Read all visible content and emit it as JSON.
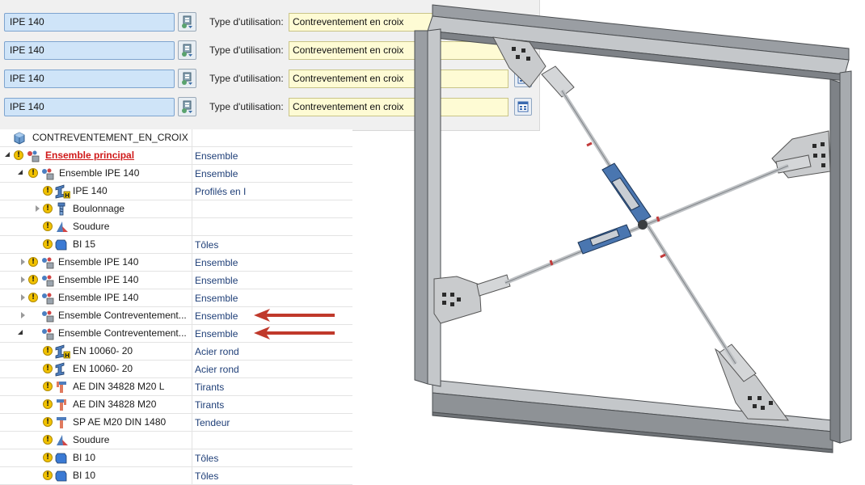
{
  "properties": [
    {
      "profile": "IPE 140",
      "usage_label": "Type d'utilisation:",
      "usage_value": "Contreventement en croix"
    },
    {
      "profile": "IPE 140",
      "usage_label": "Type d'utilisation:",
      "usage_value": "Contreventement en croix"
    },
    {
      "profile": "IPE 140",
      "usage_label": "Type d'utilisation:",
      "usage_value": "Contreventement en croix"
    },
    {
      "profile": "IPE 140",
      "usage_label": "Type d'utilisation:",
      "usage_value": "Contreventement en croix"
    }
  ],
  "tree": {
    "root_label": "CONTREVENTEMENT_EN_CROIX",
    "rows": [
      {
        "name": "Ensemble principal",
        "type": "Ensemble",
        "icon": "assembly-icon"
      },
      {
        "name": "Ensemble IPE 140",
        "type": "Ensemble",
        "icon": "assembly-icon"
      },
      {
        "name": "IPE 140",
        "type": "Profilés en I",
        "icon": "beam-icon"
      },
      {
        "name": "Boulonnage",
        "type": "",
        "icon": "bolt-icon"
      },
      {
        "name": "Soudure",
        "type": "",
        "icon": "weld-icon"
      },
      {
        "name": "BI 15",
        "type": "Tôles",
        "icon": "plate-icon"
      },
      {
        "name": "Ensemble IPE 140",
        "type": "Ensemble",
        "icon": "assembly-icon"
      },
      {
        "name": "Ensemble IPE 140",
        "type": "Ensemble",
        "icon": "assembly-icon"
      },
      {
        "name": "Ensemble IPE 140",
        "type": "Ensemble",
        "icon": "assembly-icon"
      },
      {
        "name": "Ensemble Contreventement...",
        "type": "Ensemble",
        "icon": "assembly-icon"
      },
      {
        "name": "Ensemble Contreventement...",
        "type": "Ensemble",
        "icon": "assembly-icon"
      },
      {
        "name": "EN 10060- 20",
        "type": "Acier rond",
        "icon": "beam-icon"
      },
      {
        "name": "EN 10060- 20",
        "type": "Acier rond",
        "icon": "beam-icon"
      },
      {
        "name": "AE DIN 34828 M20 L",
        "type": "Tirants",
        "icon": "tie-rod-icon"
      },
      {
        "name": "AE DIN 34828 M20",
        "type": "Tirants",
        "icon": "tie-rod-icon"
      },
      {
        "name": "SP AE M20 DIN 1480",
        "type": "Tendeur",
        "icon": "turnbuckle-icon"
      },
      {
        "name": "Soudure",
        "type": "",
        "icon": "weld-icon"
      },
      {
        "name": "BI 10",
        "type": "Tôles",
        "icon": "plate-icon"
      },
      {
        "name": "BI 10",
        "type": "Tôles",
        "icon": "plate-icon"
      }
    ]
  },
  "colors": {
    "profile_field_bg": "#cfe4f8",
    "usage_field_bg": "#fefbd4",
    "link_red": "#d01a1a",
    "type_text": "#1f3f78",
    "arrow_red": "#c0392b"
  }
}
